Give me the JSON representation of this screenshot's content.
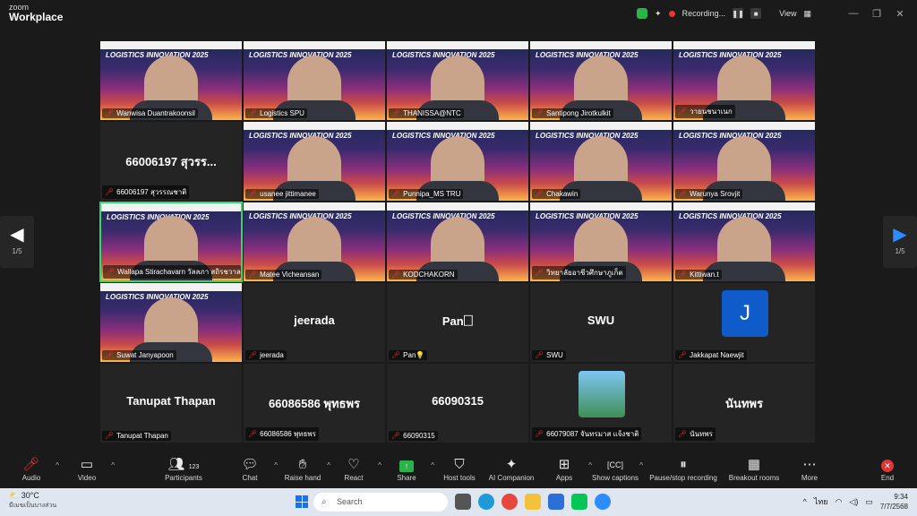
{
  "app": {
    "brand_top": "zoom",
    "brand_bottom": "Workplace"
  },
  "titlebar": {
    "recording": "Recording...",
    "view": "View",
    "minimize": "—",
    "restore": "❐",
    "close": "✕"
  },
  "pager": {
    "left_page": "1/5",
    "right_page": "1/5"
  },
  "banner": "LOGISTICS INNOVATION 2025",
  "tiles": [
    {
      "name": "Wanwisa Duantrakoonsil",
      "type": "video"
    },
    {
      "name": "Logistics SPU",
      "type": "video"
    },
    {
      "name": "THANISSA@NTC",
      "type": "video"
    },
    {
      "name": "Santipong Jirotkulkit",
      "type": "video"
    },
    {
      "name": "วายนชนาเนก",
      "type": "video"
    },
    {
      "name": "66006197 สุวรรณชาติ",
      "type": "name",
      "display": "66006197 สุวรร..."
    },
    {
      "name": "usanee jittimanee",
      "type": "video"
    },
    {
      "name": "Punnipa_MS TRU",
      "type": "video"
    },
    {
      "name": "Chakawin",
      "type": "video"
    },
    {
      "name": "Warunya Srovjit",
      "type": "video"
    },
    {
      "name": "Wallapa Stirachavarn วัลลภา สถิรชวาล",
      "type": "video",
      "active": true
    },
    {
      "name": "Matee Vicheansan",
      "type": "video"
    },
    {
      "name": "KODCHAKORN",
      "type": "video"
    },
    {
      "name": "วิทยาลัยอาชีวศึกษาภูเก็ต",
      "type": "video"
    },
    {
      "name": "Kittiwan.t",
      "type": "video"
    },
    {
      "name": "Suwat Janyapoon",
      "type": "video"
    },
    {
      "name": "jeerada",
      "type": "name",
      "display": "jeerada"
    },
    {
      "name": "Pan💡",
      "type": "name",
      "display": "Pan🗌"
    },
    {
      "name": "SWU",
      "type": "name",
      "display": "SWU"
    },
    {
      "name": "Jakkapat Naewjit",
      "type": "avatar",
      "initial": "J"
    },
    {
      "name": "Tanupat Thapan",
      "type": "name",
      "display": "Tanupat Thapan"
    },
    {
      "name": "66086586 พุทธพร",
      "type": "name",
      "display": "66086586 พุทธพร"
    },
    {
      "name": "66090315",
      "type": "name",
      "display": "66090315"
    },
    {
      "name": "66079087 จันทรมาส แจ้งชาติ",
      "type": "photo"
    },
    {
      "name": "นันทพร",
      "type": "name",
      "display": "นันทพร"
    }
  ],
  "toolbar": {
    "audio": "Audio",
    "video": "Video",
    "participants": "Participants",
    "participants_count": "123",
    "chat": "Chat",
    "raise_hand": "Raise hand",
    "react": "React",
    "share": "Share",
    "host_tools": "Host tools",
    "ai_companion": "AI Companion",
    "apps": "Apps",
    "show_captions": "Show captions",
    "pause_recording": "Pause/stop recording",
    "breakout_rooms": "Breakout rooms",
    "more": "More",
    "end": "End"
  },
  "taskbar": {
    "temp": "30°C",
    "weather": "มีเมฆเป็นบางส่วน",
    "search_placeholder": "Search",
    "lang": "ไทย",
    "time": "9:34",
    "date": "7/7/2568"
  }
}
